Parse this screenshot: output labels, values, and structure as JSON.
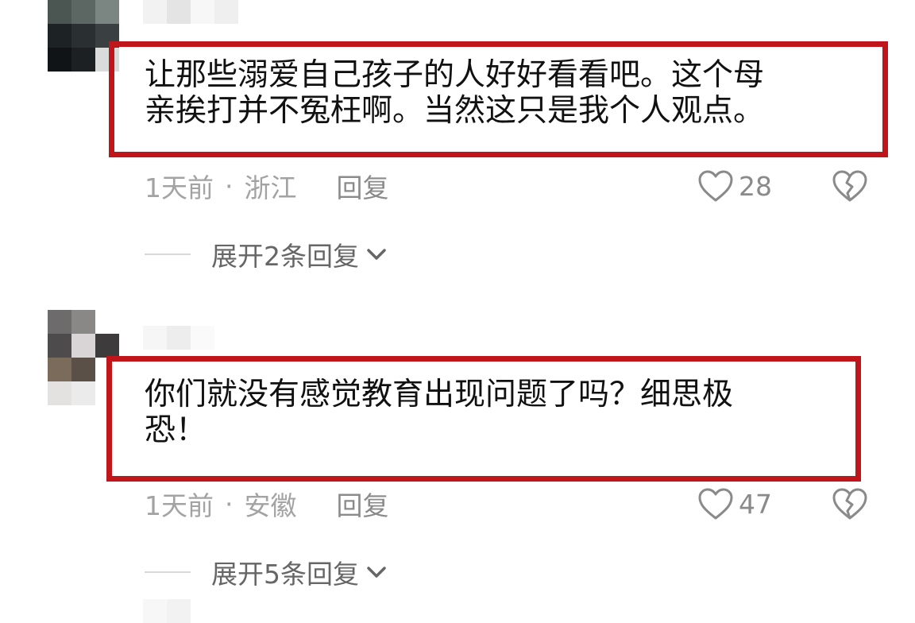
{
  "comments": [
    {
      "text_line1": "让那些溺爱自己孩子的人好好看看吧。这个母",
      "text_line2": "亲挨打并不冤枉啊。当然这只是我个人观点。",
      "time": "1天前",
      "separator": "·",
      "location": "浙江",
      "reply_label": "回复",
      "likes": "28",
      "like_icon": "heart-outline-icon",
      "dislike_icon": "broken-heart-icon",
      "expand_label": "展开2条回复"
    },
    {
      "text_line1": "你们就没有感觉教育出现问题了吗？细思极",
      "text_line2": "恐！",
      "time": "1天前",
      "separator": "·",
      "location": "安徽",
      "reply_label": "回复",
      "likes": "47",
      "like_icon": "heart-outline-icon",
      "dislike_icon": "broken-heart-icon",
      "expand_label": "展开5条回复"
    }
  ],
  "colors": {
    "highlight_border": "#c0161b",
    "meta_text": "#a3a3a3",
    "icon": "#8a8a8a",
    "expand_text": "#666666"
  }
}
